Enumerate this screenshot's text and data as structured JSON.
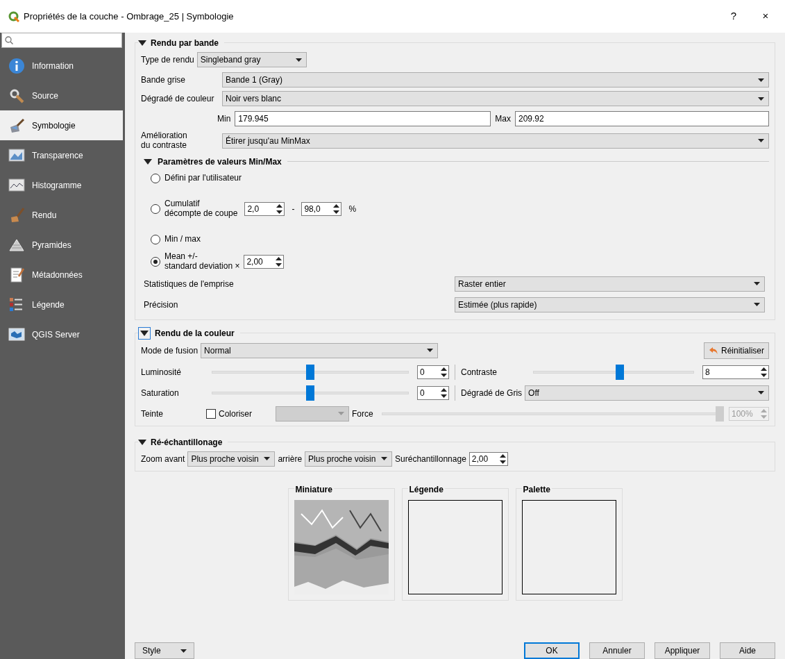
{
  "window": {
    "title": "Propriétés de la couche - Ombrage_25 | Symbologie",
    "help_button": "?",
    "close_button": "×"
  },
  "sidebar": {
    "items": [
      {
        "label": "Information",
        "selected": false
      },
      {
        "label": "Source",
        "selected": false
      },
      {
        "label": "Symbologie",
        "selected": true
      },
      {
        "label": "Transparence",
        "selected": false
      },
      {
        "label": "Histogramme",
        "selected": false
      },
      {
        "label": "Rendu",
        "selected": false
      },
      {
        "label": "Pyramides",
        "selected": false
      },
      {
        "label": "Métadonnées",
        "selected": false
      },
      {
        "label": "Légende",
        "selected": false
      },
      {
        "label": "QGIS Server",
        "selected": false
      }
    ]
  },
  "band_rendering": {
    "title": "Rendu par bande",
    "expanded": true,
    "render_type_label": "Type de rendu",
    "render_type": "Singleband gray",
    "gray_band_label": "Bande grise",
    "gray_band": "Bande 1 (Gray)",
    "gradient_label": "Dégradé de couleur",
    "gradient": "Noir vers blanc",
    "min_label": "Min",
    "min": "179.945",
    "max_label": "Max",
    "max": "209.92",
    "contrast_label": [
      "Amélioration",
      "du contraste"
    ],
    "contrast": "Étirer jusqu'au MinMax",
    "minmax": {
      "title": "Paramètres de valeurs Min/Max",
      "expanded": true,
      "options": [
        {
          "kind": "plain",
          "label": [
            "Défini par l'utilisateur"
          ],
          "selected": false
        },
        {
          "kind": "range",
          "label": [
            "Cumulatif",
            "décompte de coupe"
          ],
          "selected": false,
          "from": "2,0",
          "separator": "-",
          "to": "98,0",
          "unit": "%"
        },
        {
          "kind": "plain",
          "label": [
            "Min / max"
          ],
          "selected": false
        },
        {
          "kind": "factor",
          "label": [
            "Mean +/-",
            "standard deviation ×"
          ],
          "selected": true,
          "value": "2,00"
        }
      ],
      "extent_label": "Statistiques de l'emprise",
      "extent": "Raster entier",
      "accuracy_label": "Précision",
      "accuracy": "Estimée (plus rapide)"
    }
  },
  "color_rendering": {
    "title": "Rendu de la couleur",
    "expanded": true,
    "focused": true,
    "blend_label": "Mode de fusion",
    "blend": "Normal",
    "reset_button": "Réinitialiser",
    "brightness": {
      "label": "Luminosité",
      "level": 0.5,
      "value": "0"
    },
    "contrast": {
      "label": "Contraste",
      "level": 0.54,
      "value": "8"
    },
    "saturation": {
      "label": "Saturation",
      "level": 0.5,
      "value": "0"
    },
    "grayscale_label": "Dégradé de Gris",
    "grayscale": "Off",
    "hue_label": "Teinte",
    "colorize_label": "Coloriser",
    "colorize": false,
    "strength_label": "Force",
    "strength": {
      "level": 1,
      "value": "100%",
      "disabled": true
    }
  },
  "resampling": {
    "title": "Ré-échantillonage",
    "expanded": true,
    "zoom_in_label": "Zoom avant",
    "zoom_in": "Plus proche voisin",
    "zoom_out_label": "arrière",
    "zoom_out": "Plus proche voisin",
    "oversampling_label": "Suréchantillonnage",
    "oversampling": "2,00"
  },
  "previews": [
    {
      "title": "Miniature",
      "kind": "picture"
    },
    {
      "title": "Légende",
      "kind": "empty"
    },
    {
      "title": "Palette",
      "kind": "empty"
    }
  ],
  "footer": {
    "style_button": "Style",
    "buttons": [
      {
        "label": "OK",
        "default": true
      },
      {
        "label": "Annuler",
        "default": false
      },
      {
        "label": "Appliquer",
        "default": false
      },
      {
        "label": "Aide",
        "default": false
      }
    ]
  }
}
